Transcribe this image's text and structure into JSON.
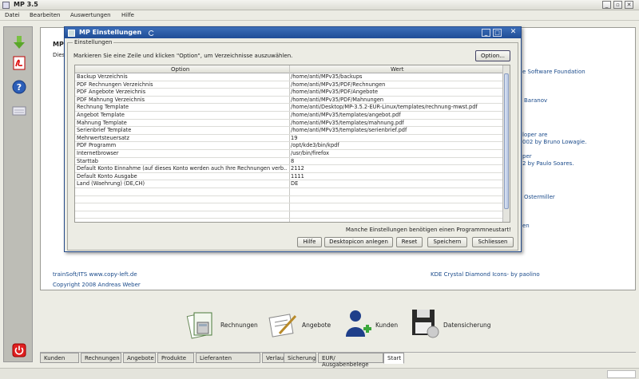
{
  "window": {
    "title": "MP 3.5",
    "minimize": "_",
    "maximize": "▫",
    "close": "✕"
  },
  "menu": [
    "Datei",
    "Bearbeiten",
    "Auswertungen",
    "Hilfe"
  ],
  "toolbar_icons": [
    "download-icon",
    "pdf-icon",
    "help-icon",
    "keyboard-icon",
    "power-icon"
  ],
  "background": {
    "heading": "MP",
    "line": "Dies",
    "right_texts": [
      "e Software Foundation",
      "Baranov",
      "loper are",
      "002 by Bruno Lowagie.",
      "per",
      "2 by Paulo Soares.",
      "Ostermiller",
      "en"
    ],
    "footer_left": "trainSoft/ITS www.copy-left.de",
    "footer_copyright": "Copyright 2008 Andreas Weber",
    "footer_right": "KDE Crystal Diamond Icons- by paolino"
  },
  "actions": [
    {
      "label": "Rechnungen"
    },
    {
      "label": "Angebote"
    },
    {
      "label": "Kunden"
    },
    {
      "label": "Datensicherung"
    }
  ],
  "tabs": [
    "Kunden",
    "Rechnungen",
    "Angebote",
    "Produkte",
    "Lieferanten",
    "Verlauf",
    "Sicherung",
    "EUR/ Ausgabenbelege",
    "Start"
  ],
  "active_tab": "Start",
  "dialog": {
    "title": "MP Einstellungen",
    "group_label": "Einstellungen",
    "hint": "Markieren Sie eine Zeile und klicken \"Option\", um Verzeichnisse auszuwählen.",
    "option_button": "Option...",
    "columns": [
      "Option",
      "Wert"
    ],
    "rows": [
      [
        "Backup Verzeichnis",
        "/home/anti/MPv35/backups"
      ],
      [
        "PDF Rechnungen Verzeichnis",
        "/home/anti/MPv35/PDF/Rechnungen"
      ],
      [
        "PDF Angebote Verzeichnis",
        "/home/anti/MPv35/PDF/Angebote"
      ],
      [
        "PDF Mahnung Verzeichnis",
        "/home/anti/MPv35/PDF/Mahnungen"
      ],
      [
        "Rechnung Template",
        "/home/anti/Desktop/MP-3.5.2-EUR-Linux/templates/rechnung-mwst.pdf"
      ],
      [
        "Angebot Template",
        "/home/anti/MPv35/templates/angebot.pdf"
      ],
      [
        "Mahnung Template",
        "/home/anti/MPv35/templates/mahnung.pdf"
      ],
      [
        "Serienbrief Template",
        "/home/anti/MPv35/templates/serienbrief.pdf"
      ],
      [
        "Mehrwertsteuersatz",
        "19"
      ],
      [
        "PDF Programm",
        "/opt/kde3/bin/kpdf"
      ],
      [
        "Internetbrowser",
        "/usr/bin/firefox"
      ],
      [
        "Starttab",
        "8"
      ],
      [
        "Default Konto Einnahme (auf dieses Konto werden auch Ihre Rechnungen verb...",
        "2112"
      ],
      [
        "Default Konto Ausgabe",
        "1111"
      ],
      [
        "Land (Waehrung) (DE,CH)",
        "DE"
      ],
      [
        "",
        ""
      ],
      [
        "",
        ""
      ],
      [
        "",
        ""
      ],
      [
        "",
        ""
      ]
    ],
    "restart_note": "Manche Einstellungen benötigen einen Programmneustart!",
    "buttons": [
      "Hilfe",
      "Desktopicon anlegen",
      "Reset",
      "Speichern",
      "Schliessen"
    ]
  }
}
